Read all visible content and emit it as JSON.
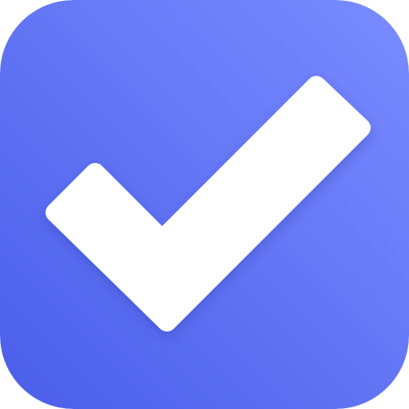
{
  "icon": {
    "name": "checkmark",
    "glyph": "check-icon",
    "colors": {
      "background_top_right": "#7a8cff",
      "background_bottom_left": "#4a5eea",
      "check": "#ffffff",
      "shadow": "#2a3aa8"
    }
  }
}
